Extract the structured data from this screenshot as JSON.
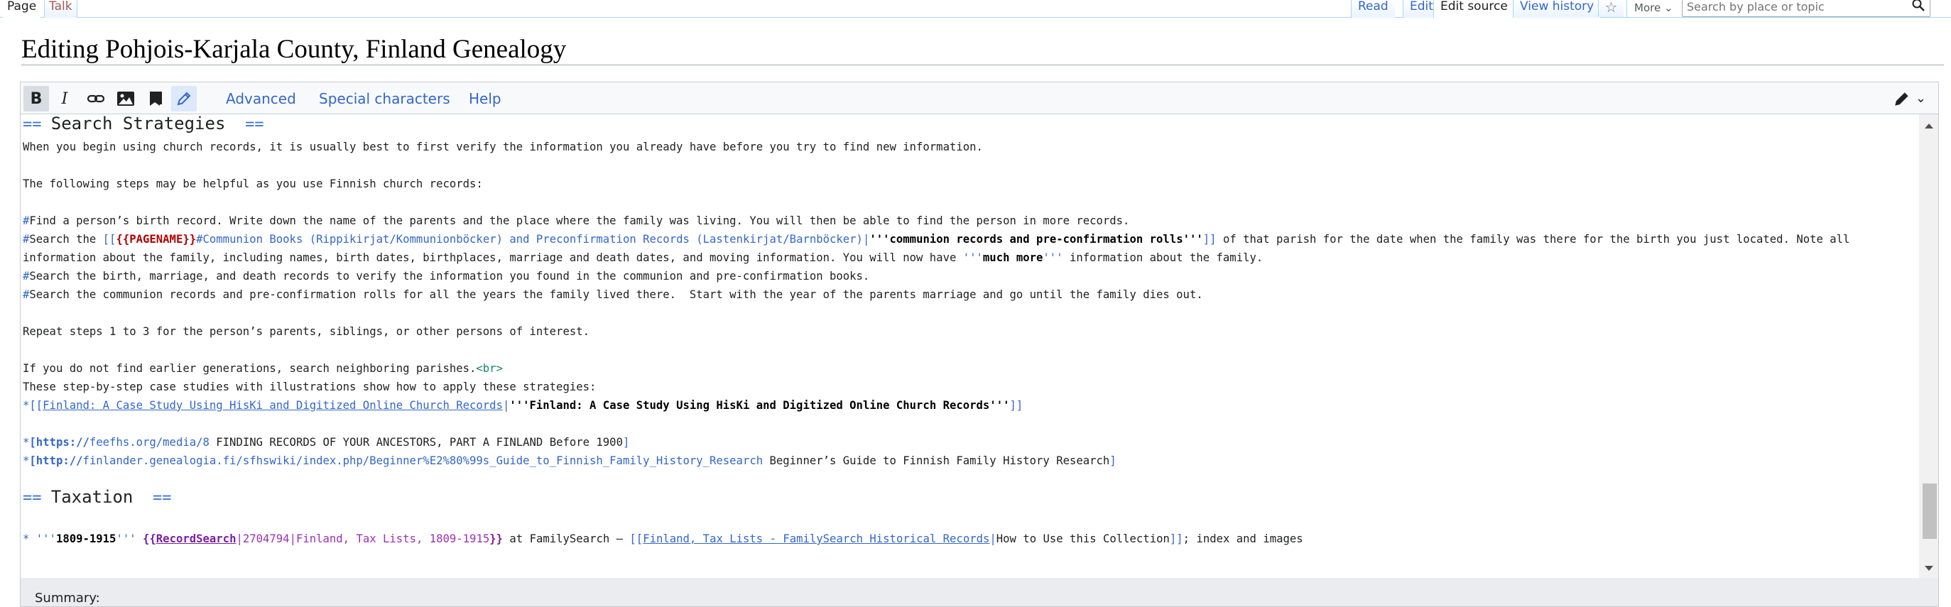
{
  "nav": {
    "namespace_tabs": [
      "Page",
      "Talk"
    ],
    "view_tabs": [
      "Read",
      "Edit",
      "Edit source",
      "View history"
    ],
    "more_label": "More",
    "search_placeholder": "Search by place or topic"
  },
  "page_title": "Editing Pohjois-Karjala County, Finland Genealogy",
  "toolbar": {
    "bold_label": "B",
    "italic_label": "I",
    "advanced_label": "Advanced",
    "special_characters_label": "Special characters",
    "help_label": "Help"
  },
  "wikitext": {
    "heading_search": {
      "open": "== ",
      "text": "Search Strategies ",
      "close": " =="
    },
    "p1": "When you begin using church records, it is usually best to first verify the information you already have before you try to find new information.",
    "p2": "The following steps may be helpful as you use Finnish church records:",
    "steps": {
      "s1": "Find a person’s birth record. Write down the name of the parents and the place where the family was living. You will then be able to find the person in more records.",
      "s2_pre": "Search the ",
      "s2_open": "[[",
      "s2_tpl": "{{PAGENAME}}",
      "s2_link": "#Communion Books (Rippikirjat/Kommunionböcker) and Preconfirmation Records (Lastenkirjat/Barnböcker)",
      "s2_pipe": "|",
      "s2_b1": "'''",
      "s2_bold": "communion records and pre-confirmation rolls",
      "s2_b2": "'''",
      "s2_close": "]]",
      "s2_post": " of that parish for the date when the family was there for the birth you just located. Note all",
      "s2_line2_pre": "information about the family, including names, birth dates, birthplaces, marriage and death dates, and moving information. You will now have ",
      "s2_line2_b1": "'''",
      "s2_line2_bold": "much more",
      "s2_line2_b2": "'''",
      "s2_line2_post": " information about the family.",
      "s3": "Search the birth, marriage, and death records to verify the information you found in the communion and pre-confirmation books.",
      "s4": "Search the communion records and pre-confirmation rolls for all the years the family lived there.  Start with the year of the parents marriage and go until the family dies out."
    },
    "list_marker": "#",
    "bullet_marker": "*",
    "p3": "Repeat steps 1 to 3 for the person’s parents, siblings, or other persons of interest.",
    "p4": "If you do not find earlier generations, search neighboring parishes.",
    "br_tag": "<br>",
    "p5": "These step-by-step case studies with illustrations show how to apply these strategies:",
    "case_link": {
      "open": "[[",
      "target": "Finland: A Case Study Using HisKi and Digitized Online Church Records",
      "pipe": "|",
      "b1": "'''",
      "bold": "Finland: A Case Study Using HisKi and Digitized Online Church Records",
      "b2": "'''",
      "close": "]]"
    },
    "ext1": {
      "open": "[",
      "scheme": "https://",
      "url": "feefhs.org/media/8",
      "text": " FINDING RECORDS OF YOUR ANCESTORS, PART A FINLAND Before 1900",
      "close": "]"
    },
    "ext2": {
      "open": "[",
      "scheme": "http://",
      "url": "finlander.genealogia.fi/sfhswiki/index.php/Beginner%E2%80%99s_Guide_to_Finnish_Family_History_Research",
      "text": " Beginner’s Guide to Finnish Family History Research",
      "close": "]"
    },
    "heading_tax": {
      "open": "== ",
      "text": "Taxation ",
      "close": " =="
    },
    "tax": {
      "bullet": "* ",
      "b1": "'''",
      "years": "1809-1915",
      "b2": "'''",
      "sp": " ",
      "tpl_open": "{{",
      "tpl_name": "RecordSearch",
      "tpl_rest": "|2704794|Finland, Tax Lists, 1809-1915",
      "tpl_close": "}}",
      "mid": " at FamilySearch – ",
      "link_open": "[[",
      "link_target": "Finland, Tax Lists - FamilySearch Historical Records",
      "link_pipe": "|",
      "link_text": "How to Use this Collection",
      "link_close": "]]",
      "post": "; index and images"
    }
  },
  "summary_label": "Summary:"
}
